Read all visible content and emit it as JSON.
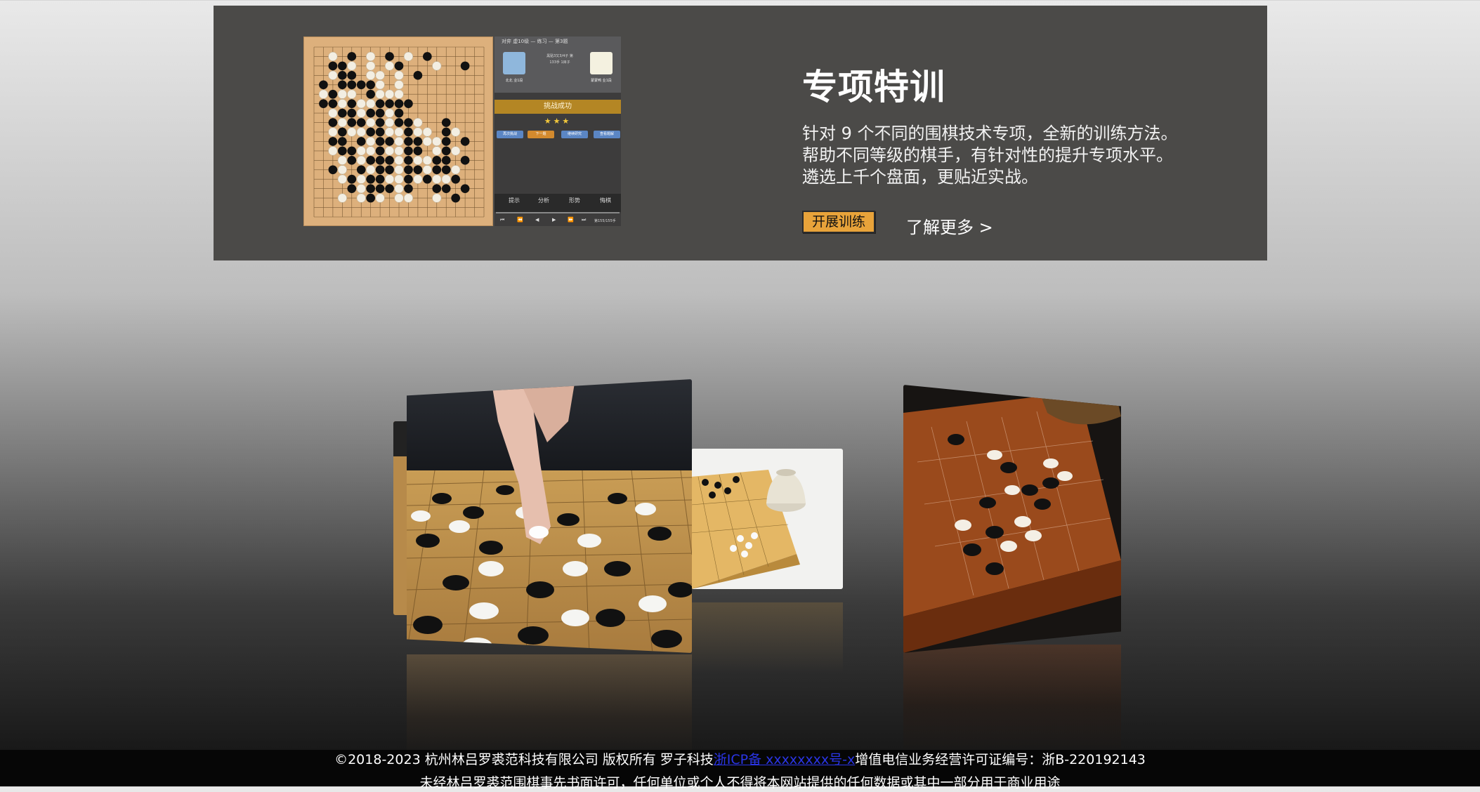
{
  "feature": {
    "title": "专项特训",
    "description": [
      "针对 9 个不同的围棋技术专项，全新的训练方法。",
      "帮助不同等级的棋手，有针对性的提升专项水平。",
      "遴选上千个盘面，更贴近实战。"
    ],
    "start_button": "开展训练",
    "more_link": "了解更多 >",
    "screenshot": {
      "caption": "对弈 虚10级 — 练习 — 第3题",
      "player_left": "北北\n业1段",
      "player_right": "蒙蒙鸭\n业1段",
      "match_info": "黑贴3又3/4子\n第133手\n1目子\n",
      "banner": "挑战成功",
      "stars": "★★★",
      "buttons": [
        "再次挑战",
        "下一题",
        "继续研究",
        "查看题解"
      ],
      "tools": [
        "提示",
        "分析",
        "形势",
        "悔棋"
      ],
      "move_counter": "第155/155手"
    }
  },
  "carousel": {
    "images": [
      "hand-placing-stone-photo",
      "board-with-bowl-photo",
      "wooden-board-photo"
    ]
  },
  "footer": {
    "copyright_prefix": "©2018-2023 杭州林吕罗裘范科技有限公司 版权所有 罗子科技",
    "icp_link": "浙ICP备 xxxxxxxx号-x",
    "license": "增值电信业务经营许可证编号：浙B-220192143",
    "notice": "未经林吕罗裘范围棋事先书面许可，任何单位或个人不得将本网站提供的任何数据或其中一部分用于商业用途"
  },
  "colors": {
    "panel_bg": "#4b4a48",
    "button_orange": "#e8a33a",
    "link_blue": "#2a35e6",
    "board_wood": "#ddb07c"
  }
}
